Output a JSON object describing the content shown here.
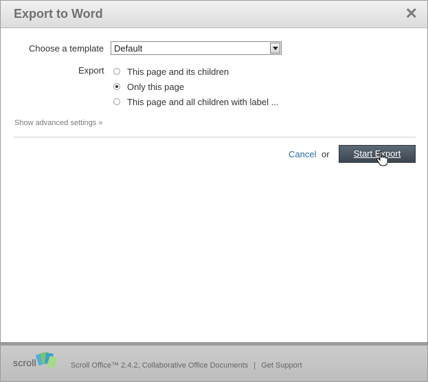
{
  "dialog": {
    "title": "Export to Word",
    "close_icon": "close-icon"
  },
  "form": {
    "template_label": "Choose a template",
    "template_selected": "Default",
    "export_label": "Export",
    "export_options": [
      {
        "label": "This page and its children",
        "checked": false
      },
      {
        "label": "Only this page",
        "checked": true
      },
      {
        "label": "This page and all children with label ...",
        "checked": false
      }
    ],
    "advanced_link": "Show advanced settings »"
  },
  "actions": {
    "cancel_label": "Cancel",
    "or_label": "or",
    "start_label": "Start Export"
  },
  "footer": {
    "logo_text": "scroll",
    "product_info": "Scroll Office™ 2.4.2, Collaborative Office Documents",
    "separator": "|",
    "support_link": "Get Support"
  },
  "colors": {
    "link": "#2a6ea6",
    "button_bg": "#4a5560",
    "title": "#707070"
  }
}
